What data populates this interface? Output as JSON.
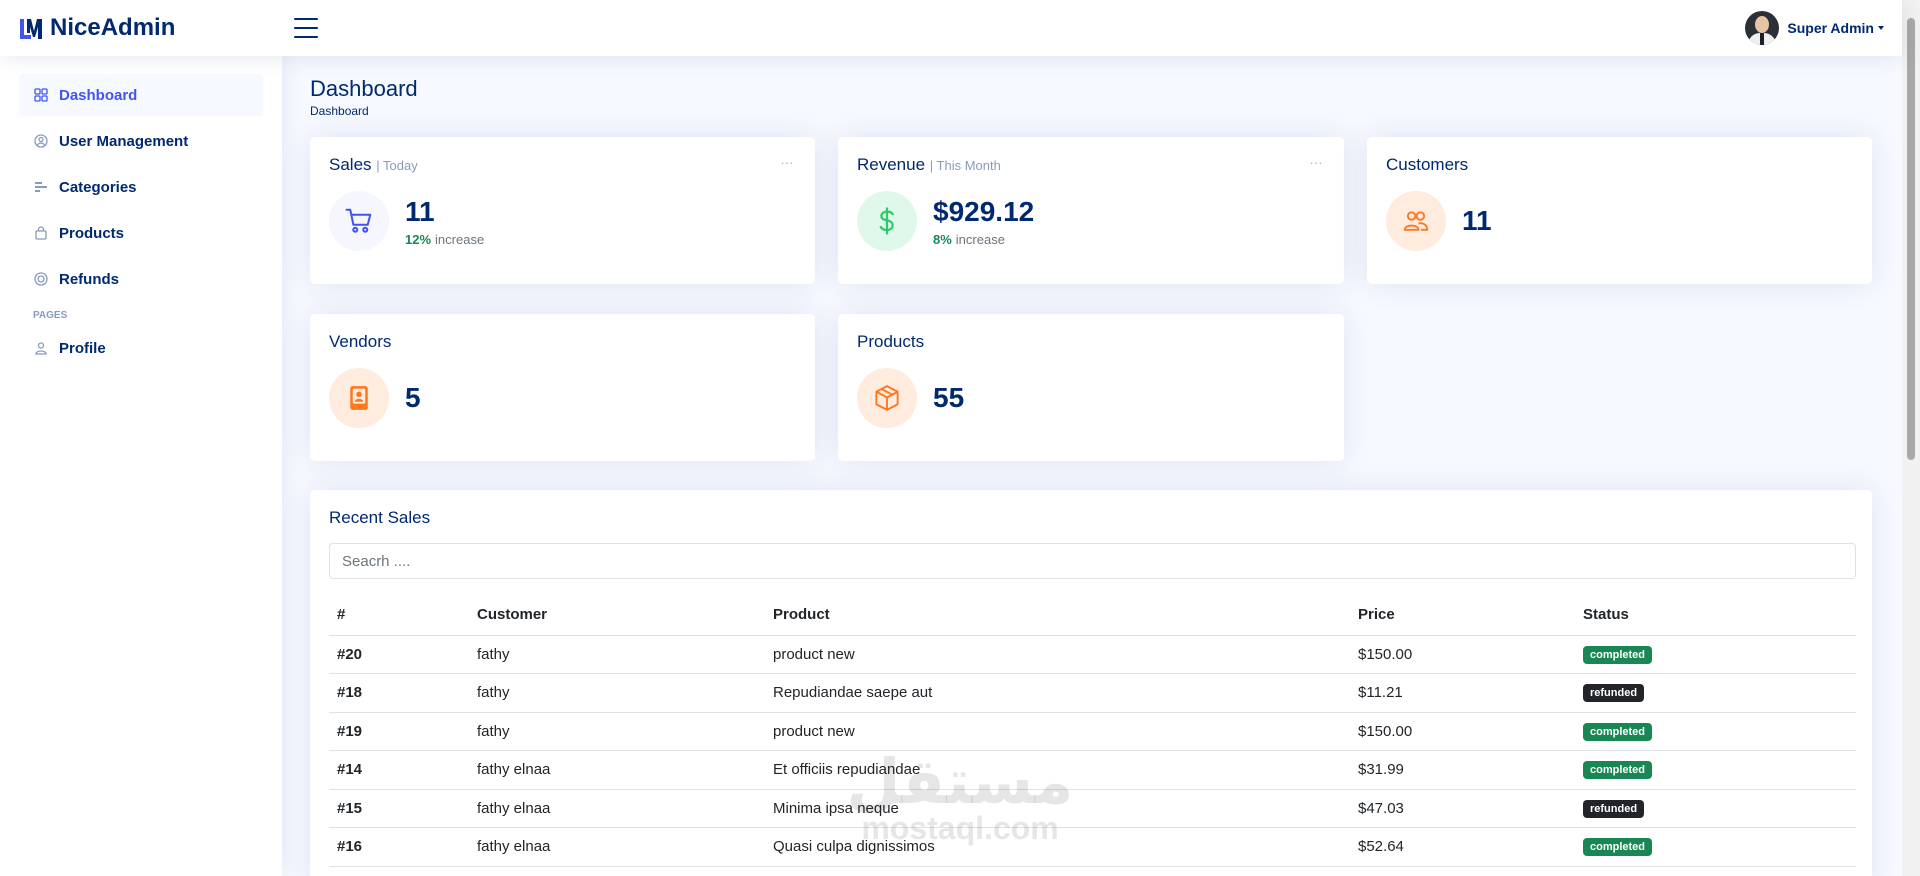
{
  "header": {
    "logo_text": "NiceAdmin",
    "user_name": "Super Admin"
  },
  "sidebar": {
    "items": [
      {
        "label": "Dashboard"
      },
      {
        "label": "User Management"
      },
      {
        "label": "Categories"
      },
      {
        "label": "Products"
      },
      {
        "label": "Refunds"
      }
    ],
    "pages_heading": "PAGES",
    "pages_items": [
      {
        "label": "Profile"
      }
    ]
  },
  "page": {
    "title": "Dashboard",
    "breadcrumb": "Dashboard"
  },
  "cards": {
    "sales": {
      "title": "Sales",
      "period": "| Today",
      "value": "11",
      "pct": "12%",
      "trend": "increase"
    },
    "revenue": {
      "title": "Revenue",
      "period": "| This Month",
      "value": "$929.12",
      "pct": "8%",
      "trend": "increase"
    },
    "customers": {
      "title": "Customers",
      "value": "11"
    },
    "vendors": {
      "title": "Vendors",
      "value": "5"
    },
    "products": {
      "title": "Products",
      "value": "55"
    },
    "more_icon": "…"
  },
  "recent_sales": {
    "title": "Recent Sales",
    "search_placeholder": "Seacrh ....",
    "columns": [
      "#",
      "Customer",
      "Product",
      "Price",
      "Status"
    ],
    "rows": [
      {
        "id": "#20",
        "customer": "fathy",
        "product": "product new",
        "price": "$150.00",
        "status": "completed"
      },
      {
        "id": "#18",
        "customer": "fathy",
        "product": "Repudiandae saepe aut",
        "price": "$11.21",
        "status": "refunded"
      },
      {
        "id": "#19",
        "customer": "fathy",
        "product": "product new",
        "price": "$150.00",
        "status": "completed"
      },
      {
        "id": "#14",
        "customer": "fathy elnaa",
        "product": "Et officiis repudiandae",
        "price": "$31.99",
        "status": "completed"
      },
      {
        "id": "#15",
        "customer": "fathy elnaa",
        "product": "Minima ipsa neque",
        "price": "$47.03",
        "status": "refunded"
      },
      {
        "id": "#16",
        "customer": "fathy elnaa",
        "product": "Quasi culpa dignissimos",
        "price": "$52.64",
        "status": "completed"
      }
    ]
  },
  "watermark": {
    "arabic": "مستقل",
    "latin": "mostaql.com"
  },
  "colors": {
    "primary": "#4154f1",
    "navy": "#012970",
    "success": "#198754",
    "dark": "#212529",
    "sales_icon_bg": "#f6f6fe",
    "revenue_icon_bg": "#e0f8e9",
    "orange_icon_bg": "#ffecdf",
    "orange": "#ff771d",
    "green": "#2eca6a"
  },
  "icons": {
    "sidebar": [
      "grid-icon",
      "person-circle-icon",
      "list-icon",
      "bag-icon",
      "coin-icon",
      "person-icon"
    ],
    "cards": [
      "cart-icon",
      "currency-dollar-icon",
      "people-icon",
      "vendor-badge-icon",
      "box-icon"
    ]
  }
}
